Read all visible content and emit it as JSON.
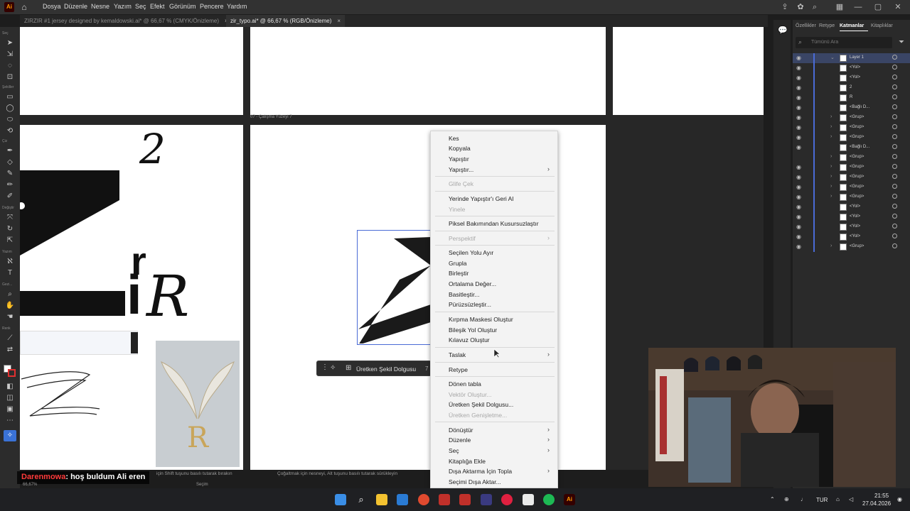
{
  "app": {
    "logo_text": "Ai",
    "menu": [
      "Dosya",
      "Düzenle",
      "Nesne",
      "Yazım",
      "Seç",
      "Efekt",
      "Görünüm",
      "Pencere",
      "Yardım"
    ]
  },
  "tabs": [
    {
      "label": "ZIRZIR #1 jersey designed by kemaldowski.ai* @ 66,67 % (CMYK/Önizleme)",
      "close": "×"
    },
    {
      "label": "zir_typo.ai* @ 66,67 % (RGB/Önizleme)",
      "close": "×"
    }
  ],
  "toolbar": {
    "labels": [
      "Seç",
      "Şekiller",
      "Çiz",
      "Değiştir",
      "Yazım",
      "Gezi...",
      "Renk"
    ]
  },
  "canvas": {
    "artboard_label": "07 - Çalışma Yüzeyi 7",
    "glyph_2": "2",
    "glyph_R": "R",
    "glyph_r": "r",
    "glyph_i": "i"
  },
  "floating_bar": {
    "button": "Üretken Şekil Dolgusu",
    "sep_text": "7"
  },
  "context_menu": {
    "items": [
      {
        "label": "Kes",
        "disabled": false,
        "submenu": false
      },
      {
        "label": "Kopyala",
        "disabled": false,
        "submenu": false
      },
      {
        "label": "Yapıştır",
        "disabled": false,
        "submenu": false
      },
      {
        "label": "Yapıştır...",
        "disabled": false,
        "submenu": true
      },
      {
        "label": "Glife Çek",
        "disabled": true,
        "submenu": false
      },
      {
        "label": "Yerinde Yapıştır'ı Geri Al",
        "disabled": false,
        "submenu": false
      },
      {
        "label": "Yinele",
        "disabled": true,
        "submenu": false
      },
      {
        "label": "Piksel Bakımından Kusursuzlaştır",
        "disabled": false,
        "submenu": false
      },
      {
        "label": "Perspektif",
        "disabled": true,
        "submenu": true
      },
      {
        "label": "Seçilen Yolu Ayır",
        "disabled": false,
        "submenu": false
      },
      {
        "label": "Grupla",
        "disabled": false,
        "submenu": false
      },
      {
        "label": "Birleştir",
        "disabled": false,
        "submenu": false
      },
      {
        "label": "Ortalama Değer...",
        "disabled": false,
        "submenu": false
      },
      {
        "label": "Basitleştir...",
        "disabled": false,
        "submenu": false
      },
      {
        "label": "Pürüzsüzleştir...",
        "disabled": false,
        "submenu": false
      },
      {
        "label": "Kırpma Maskesi Oluştur",
        "disabled": false,
        "submenu": false
      },
      {
        "label": "Bileşik Yol Oluştur",
        "disabled": false,
        "submenu": false
      },
      {
        "label": "Kılavuz Oluştur",
        "disabled": false,
        "submenu": false
      },
      {
        "label": "Taslak",
        "disabled": false,
        "submenu": true
      },
      {
        "label": "Retype",
        "disabled": false,
        "submenu": false
      },
      {
        "label": "Dönen tabla",
        "disabled": false,
        "submenu": false
      },
      {
        "label": "Vektör Oluştur...",
        "disabled": true,
        "submenu": false
      },
      {
        "label": "Üretken Şekil Dolgusu...",
        "disabled": false,
        "submenu": false
      },
      {
        "label": "Üretken Genişletme...",
        "disabled": true,
        "submenu": false
      },
      {
        "label": "Dönüştür",
        "disabled": false,
        "submenu": true
      },
      {
        "label": "Düzenle",
        "disabled": false,
        "submenu": true
      },
      {
        "label": "Seç",
        "disabled": false,
        "submenu": true
      },
      {
        "label": "Kitaplığa Ekle",
        "disabled": false,
        "submenu": false
      },
      {
        "label": "Dışa Aktarma İçin Topla",
        "disabled": false,
        "submenu": true
      },
      {
        "label": "Seçimi Dışa Aktar...",
        "disabled": false,
        "submenu": false
      }
    ]
  },
  "panel": {
    "tabs": [
      "Özellikler",
      "Retype",
      "Katmanlar",
      "Kitaplıklar"
    ],
    "active_tab": "Katmanlar",
    "search_placeholder": "Tümünü Ara",
    "layers": [
      {
        "name": "Layer 1",
        "eye": true,
        "chev": "v"
      },
      {
        "name": "<Yol>",
        "eye": true,
        "chev": ""
      },
      {
        "name": "<Yol>",
        "eye": true,
        "chev": ""
      },
      {
        "name": "2",
        "eye": true,
        "chev": ""
      },
      {
        "name": "R",
        "eye": true,
        "chev": ""
      },
      {
        "name": "<Bağlı D...",
        "eye": true,
        "chev": ""
      },
      {
        "name": "<Grup>",
        "eye": true,
        "chev": ">"
      },
      {
        "name": "<Grup>",
        "eye": true,
        "chev": ">"
      },
      {
        "name": "<Grup>",
        "eye": true,
        "chev": ">"
      },
      {
        "name": "<Bağlı D...",
        "eye": true,
        "chev": ""
      },
      {
        "name": "<Grup>",
        "eye": false,
        "chev": ">"
      },
      {
        "name": "<Grup>",
        "eye": true,
        "chev": ">"
      },
      {
        "name": "<Grup>",
        "eye": true,
        "chev": ">"
      },
      {
        "name": "<Grup>",
        "eye": true,
        "chev": ">"
      },
      {
        "name": "<Grup>",
        "eye": true,
        "chev": ">"
      },
      {
        "name": "<Yol>",
        "eye": true,
        "chev": ""
      },
      {
        "name": "<Yol>",
        "eye": true,
        "chev": ""
      },
      {
        "name": "<Yol>",
        "eye": true,
        "chev": ""
      },
      {
        "name": "<Yol>",
        "eye": true,
        "chev": ""
      },
      {
        "name": "<Grup>",
        "eye": true,
        "chev": ">"
      }
    ]
  },
  "status": {
    "zoom": "66,67%",
    "hint": "Çoğaltmak için nesneyi, Alt tuşunu basılı tutarak sürükleyin",
    "hint2": "için Shift tuşunu basılı tutarak bırakın",
    "mode": "Seçim"
  },
  "chat": {
    "user": "Darenmowa",
    "message": ": hoş buldum Ali eren"
  },
  "taskbar": {
    "lang": "TUR",
    "time": "21:55",
    "date": "27.04.2026"
  },
  "colors": {
    "accent": "#4a6bd6",
    "ai_orange": "#ff9a00",
    "chat_user": "#ff3b3b"
  }
}
